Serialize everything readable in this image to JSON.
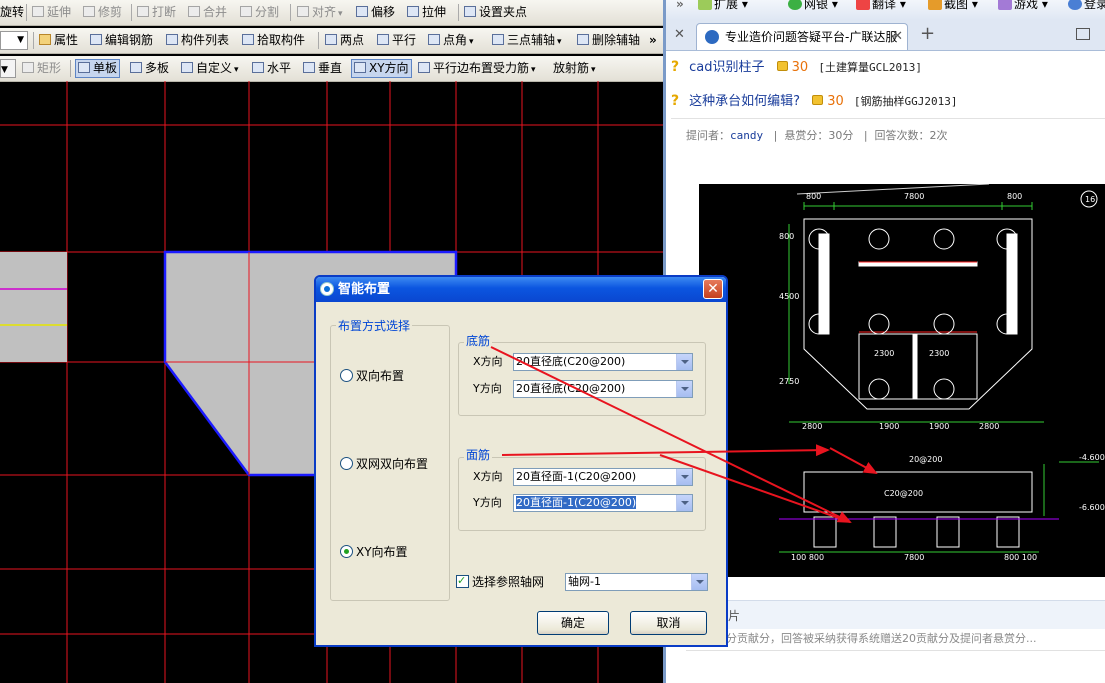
{
  "cad_app": {
    "toolbar1": {
      "items": [
        {
          "label": "旋转",
          "disabled": false
        },
        {
          "label": "延伸",
          "disabled": true
        },
        {
          "label": "修剪",
          "disabled": true
        },
        {
          "label": "打断",
          "disabled": true
        },
        {
          "label": "合并",
          "disabled": true
        },
        {
          "label": "分割",
          "disabled": true
        },
        {
          "label": "对齐",
          "disabled": true
        },
        {
          "label": "偏移",
          "disabled": false
        },
        {
          "label": "拉伸",
          "disabled": false
        },
        {
          "label": "设置夹点",
          "disabled": false
        }
      ]
    },
    "toolbar2": {
      "items": [
        {
          "label": "属性"
        },
        {
          "label": "编辑钢筋"
        },
        {
          "label": "构件列表"
        },
        {
          "label": "拾取构件"
        },
        {
          "label": "两点"
        },
        {
          "label": "平行"
        },
        {
          "label": "点角"
        },
        {
          "label": "三点辅轴"
        },
        {
          "label": "删除辅轴"
        }
      ],
      "more": "»"
    },
    "toolbar3": {
      "items": [
        {
          "label": "矩形",
          "disabled": true
        },
        {
          "label": "单板",
          "active": true
        },
        {
          "label": "多板"
        },
        {
          "label": "自定义"
        },
        {
          "label": "水平"
        },
        {
          "label": "垂直"
        },
        {
          "label": "XY方向",
          "active": true
        },
        {
          "label": "平行边布置受力筋"
        },
        {
          "label": "放射筋"
        }
      ]
    },
    "canvas_colors": {
      "background": "#000000",
      "grid": "#e8141f",
      "slab_fill": "#c0c0c0",
      "slab_border": "#1c1cff"
    }
  },
  "dialog": {
    "title": "智能布置",
    "close_label": "✕",
    "layout_group": {
      "legend": "布置方式选择",
      "options": [
        {
          "label": "双向布置",
          "selected": false
        },
        {
          "label": "双网双向布置",
          "selected": false
        },
        {
          "label": "XY向布置",
          "selected": true
        }
      ]
    },
    "bottom_group": {
      "legend": "底筋",
      "x_label": "X方向",
      "x_value": "20直径底(C20@200)",
      "y_label": "Y方向",
      "y_value": "20直径底(C20@200)"
    },
    "top_group": {
      "legend": "面筋",
      "x_label": "X方向",
      "x_value": "20直径面-1(C20@200)",
      "y_label": "Y方向",
      "y_value": "20直径面-1(C20@200)"
    },
    "axis_checkbox": {
      "label": "选择参照轴网",
      "checked": true
    },
    "axis_value": "轴网-1",
    "ok_label": "确定",
    "cancel_label": "取消"
  },
  "browser": {
    "toolbar": [
      {
        "label": "扩展",
        "icon": "puzzle-icon"
      },
      {
        "label": "网银",
        "icon": "bank-icon"
      },
      {
        "label": "翻译",
        "icon": "translate-icon"
      },
      {
        "label": "截图",
        "icon": "scissors-icon"
      },
      {
        "label": "游戏",
        "icon": "game-icon"
      },
      {
        "label": "登录",
        "icon": "search-icon"
      }
    ],
    "tab_title": "专业造价问题答疑平台-广联达服",
    "questions": [
      {
        "title": "cad识别柱子",
        "points": "30",
        "category": "[土建算量GCL2013]"
      },
      {
        "title": "这种承台如何编辑?",
        "points": "30",
        "category": "[钢筋抽样GGJ2013]"
      }
    ],
    "meta": {
      "asker_label": "提问者：",
      "asker": "candy",
      "reward": "悬赏分：30分",
      "answers": "回答次数：2次"
    },
    "image_caption": "入图片",
    "hint": "即可得2分贡献分，回答被采纳获得系统赠送20贡献分及提问者悬赏分..."
  },
  "drawing": {
    "dimensions_top": [
      "800",
      "7800",
      "800"
    ],
    "dimensions_left": [
      "800",
      "4500",
      "2750"
    ],
    "dimensions_mid": [
      "2300",
      "2300"
    ],
    "dimensions_bottom": [
      "2800",
      "1900",
      "1900",
      "2800"
    ],
    "section_bottom": [
      "100 800",
      "7800",
      "800 100"
    ],
    "marker": "16",
    "section_labels": [
      "-4.600",
      "-6.600",
      "20@200",
      "C20@200"
    ]
  }
}
